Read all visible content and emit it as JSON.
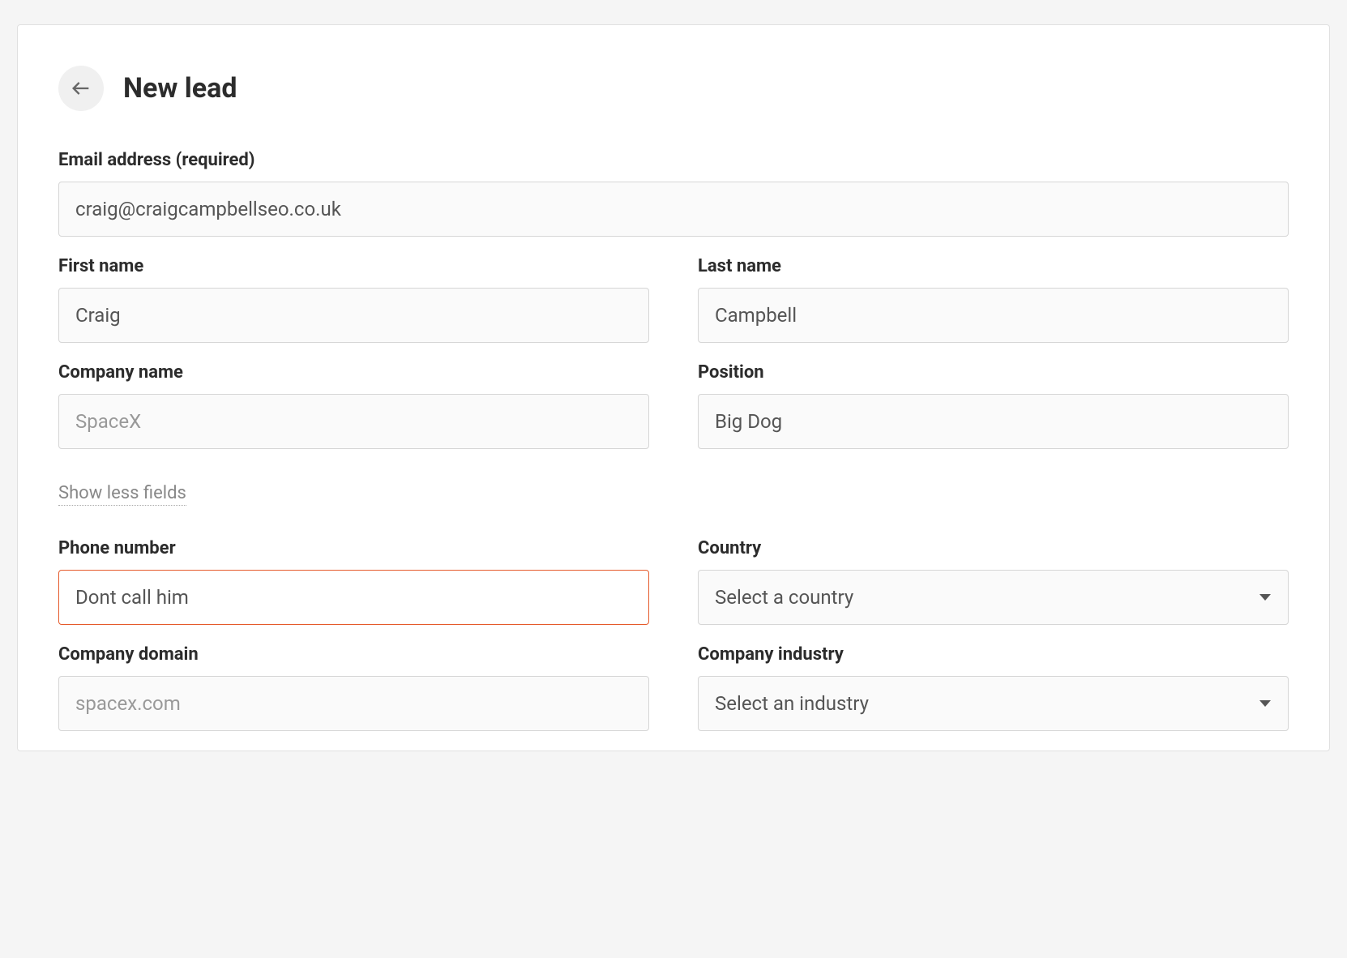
{
  "header": {
    "title": "New lead"
  },
  "form": {
    "email": {
      "label": "Email address (required)",
      "value": "craig@craigcampbellseo.co.uk"
    },
    "first_name": {
      "label": "First name",
      "value": "Craig"
    },
    "last_name": {
      "label": "Last name",
      "value": "Campbell"
    },
    "company_name": {
      "label": "Company name",
      "placeholder": "SpaceX",
      "value": ""
    },
    "position": {
      "label": "Position",
      "value": "Big Dog"
    },
    "toggle_fields": "Show less fields",
    "phone": {
      "label": "Phone number",
      "value": "Dont call him"
    },
    "country": {
      "label": "Country",
      "placeholder": "Select a country"
    },
    "company_domain": {
      "label": "Company domain",
      "placeholder": "spacex.com",
      "value": ""
    },
    "company_industry": {
      "label": "Company industry",
      "placeholder": "Select an industry"
    }
  }
}
